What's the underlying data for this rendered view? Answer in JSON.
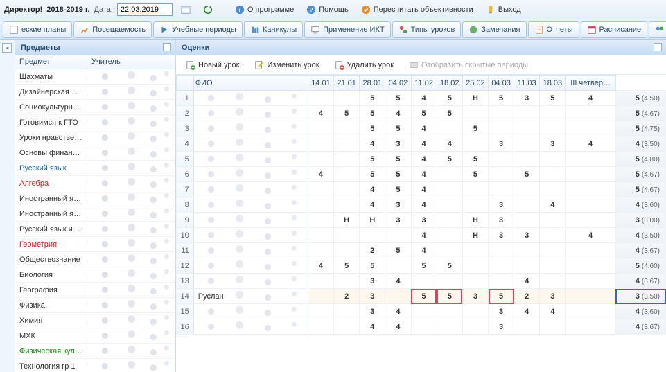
{
  "topbar": {
    "director_label": "Директор!",
    "year_label": "2018-2019 г.",
    "date_label": "Дата:",
    "date_value": "22.03.2019",
    "about": "О программе",
    "help": "Помощь",
    "recalc": "Пересчитать объективности",
    "exit": "Выход"
  },
  "nav": {
    "plans": "еские планы",
    "attendance": "Посещаемость",
    "periods": "Учебные периоды",
    "holidays": "Каникулы",
    "ikt": "Применение ИКТ",
    "lesson_types": "Типы уроков",
    "notes": "Замечания",
    "reports": "Отчеты",
    "schedule": "Расписание",
    "substitutes": "Замен"
  },
  "subjects_panel": {
    "title": "Предметы",
    "col_subject": "Предмет",
    "col_teacher": "Учитель",
    "items": [
      {
        "name": "Шахматы",
        "color": ""
      },
      {
        "name": "Дизайнерская м…",
        "color": ""
      },
      {
        "name": "Социокультурн…",
        "color": ""
      },
      {
        "name": "Готовимся к ГТО",
        "color": ""
      },
      {
        "name": "Уроки нравстве…",
        "color": ""
      },
      {
        "name": "Основы финанс…",
        "color": ""
      },
      {
        "name": "Русский язык",
        "color": "c-blue"
      },
      {
        "name": "Алгебра",
        "color": "c-red"
      },
      {
        "name": "Иностранный яз…",
        "color": ""
      },
      {
        "name": "Иностранный яз…",
        "color": ""
      },
      {
        "name": "Русский язык и …",
        "color": ""
      },
      {
        "name": "Геометрия",
        "color": "c-red"
      },
      {
        "name": "Обществознание",
        "color": ""
      },
      {
        "name": "Биология",
        "color": ""
      },
      {
        "name": "География",
        "color": ""
      },
      {
        "name": "Физика",
        "color": ""
      },
      {
        "name": "Химия",
        "color": ""
      },
      {
        "name": "МХК",
        "color": ""
      },
      {
        "name": "Физическая кул…",
        "color": "c-green"
      },
      {
        "name": "Технология гр 1",
        "color": ""
      }
    ]
  },
  "grades": {
    "title": "Оценки",
    "toolbar": {
      "new_lesson": "Новый урок",
      "edit_lesson": "Изменить урок",
      "delete_lesson": "Удалить урок",
      "show_hidden": "Отобразить скрытые периоды"
    },
    "columns": {
      "fio": "ФИО",
      "dates": [
        "14.01",
        "21.01",
        "28.01",
        "04.02",
        "11.02",
        "18.02",
        "25.02",
        "04.03",
        "11.03",
        "18.03"
      ],
      "summary": "III четвер…"
    },
    "rows": [
      {
        "n": 1,
        "fio": "",
        "marks": [
          "",
          "",
          "5",
          "5",
          "4",
          "5",
          "Н",
          "5",
          "3",
          "5",
          "4"
        ],
        "sum": "5",
        "avg": "(4.50)"
      },
      {
        "n": 2,
        "fio": "",
        "marks": [
          "4",
          "5",
          "5",
          "4",
          "5",
          "5",
          "",
          "",
          "",
          "",
          ""
        ],
        "sum": "5",
        "avg": "(4.67)"
      },
      {
        "n": 3,
        "fio": "",
        "marks": [
          "",
          "",
          "5",
          "5",
          "4",
          "",
          "5",
          "",
          "",
          "",
          ""
        ],
        "sum": "5",
        "avg": "(4.75)"
      },
      {
        "n": 4,
        "fio": "",
        "marks": [
          "",
          "",
          "4",
          "3",
          "4",
          "4",
          "",
          "3",
          "",
          "3",
          "4"
        ],
        "sum": "4",
        "avg": "(3.50)"
      },
      {
        "n": 5,
        "fio": "",
        "marks": [
          "",
          "",
          "5",
          "5",
          "4",
          "5",
          "5",
          "",
          "",
          "",
          ""
        ],
        "sum": "5",
        "avg": "(4.80)"
      },
      {
        "n": 6,
        "fio": "",
        "marks": [
          "4",
          "",
          "5",
          "5",
          "4",
          "",
          "5",
          "",
          "5",
          "",
          ""
        ],
        "sum": "5",
        "avg": "(4.67)"
      },
      {
        "n": 7,
        "fio": "",
        "marks": [
          "",
          "",
          "4",
          "5",
          "4",
          "",
          "",
          "",
          "",
          "",
          ""
        ],
        "sum": "5",
        "avg": "(4.67)"
      },
      {
        "n": 8,
        "fio": "",
        "marks": [
          "",
          "",
          "4",
          "3",
          "4",
          "",
          "",
          "3",
          "",
          "4",
          ""
        ],
        "sum": "4",
        "avg": "(3.60)"
      },
      {
        "n": 9,
        "fio": "",
        "marks": [
          "",
          "Н",
          "Н",
          "3",
          "3",
          "",
          "Н",
          "3",
          "",
          "",
          ""
        ],
        "sum": "3",
        "avg": "(3.00)"
      },
      {
        "n": 10,
        "fio": "",
        "marks": [
          "",
          "",
          "",
          "",
          "4",
          "",
          "Н",
          "3",
          "3",
          "",
          "4"
        ],
        "sum": "4",
        "avg": "(3.50)"
      },
      {
        "n": 11,
        "fio": "",
        "marks": [
          "",
          "",
          "2",
          "5",
          "4",
          "",
          "",
          "",
          "",
          "",
          ""
        ],
        "sum": "4",
        "avg": "(3.67)"
      },
      {
        "n": 12,
        "fio": "",
        "marks": [
          "4",
          "5",
          "5",
          "",
          "5",
          "5",
          "",
          "",
          "",
          "",
          ""
        ],
        "sum": "5",
        "avg": "(4.60)"
      },
      {
        "n": 13,
        "fio": "",
        "marks": [
          "",
          "",
          "3",
          "4",
          "",
          "",
          "",
          "",
          "4",
          "",
          ""
        ],
        "sum": "4",
        "avg": "(3.67)"
      },
      {
        "n": 14,
        "fio": "Руслан",
        "marks": [
          "",
          "2",
          "3",
          "",
          "5",
          "5",
          "3",
          "5",
          "2",
          "3",
          ""
        ],
        "sum": "3",
        "avg": "(3.50)",
        "hl": {
          "4": "red",
          "5": "red",
          "7": "red",
          "sum": "blue"
        },
        "selected": true
      },
      {
        "n": 15,
        "fio": "",
        "marks": [
          "",
          "",
          "3",
          "4",
          "",
          "",
          "",
          "3",
          "4",
          "4",
          ""
        ],
        "sum": "4",
        "avg": "(3.60)"
      },
      {
        "n": 16,
        "fio": "",
        "marks": [
          "",
          "",
          "4",
          "4",
          "",
          "",
          "",
          "3",
          "",
          "",
          ""
        ],
        "sum": "4",
        "avg": "(3.67)"
      }
    ]
  }
}
